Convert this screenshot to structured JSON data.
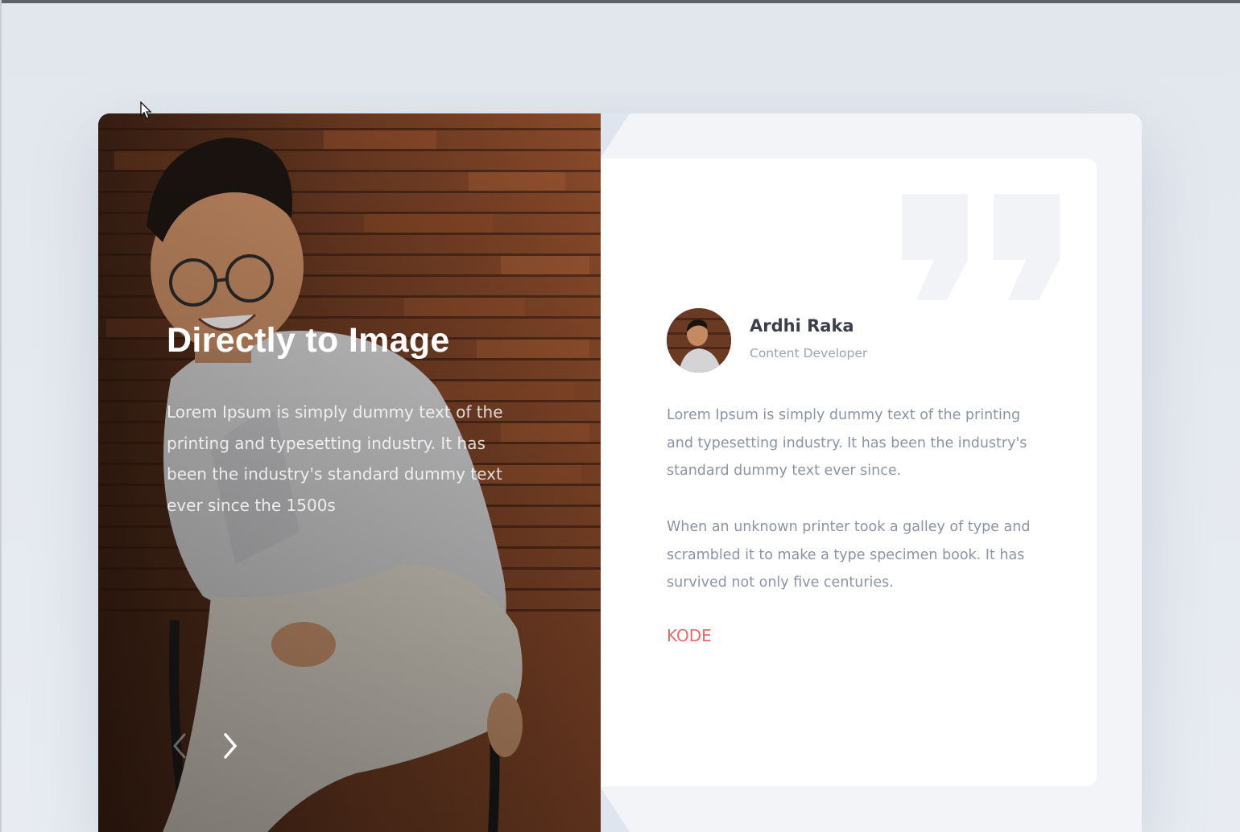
{
  "slide": {
    "title": "Directly to Image",
    "description": "Lorem Ipsum is simply dummy text of the printing and typesetting industry. It has been the industry's standard dummy text ever since the 1500s",
    "prev_icon": "chevron-left-icon",
    "next_icon": "chevron-right-icon"
  },
  "testimonial": {
    "author_name": "Ardhi Raka",
    "author_role": "Content Developer",
    "paragraph_1": "Lorem Ipsum is simply dummy text of the printing and typesetting industry. It has been the industry's standard dummy text ever since.",
    "paragraph_2": "When an unknown printer took a galley of type and scrambled it to make a type specimen book. It has survived not only five centuries.",
    "link_label": "KODE",
    "quote_icon": "quote-icon"
  },
  "colors": {
    "accent": "#e06b6b",
    "page_background": "#e4e9ef",
    "panel_background": "#ffffff",
    "text_muted": "#8b94a5",
    "heading": "#3a3f4a"
  }
}
